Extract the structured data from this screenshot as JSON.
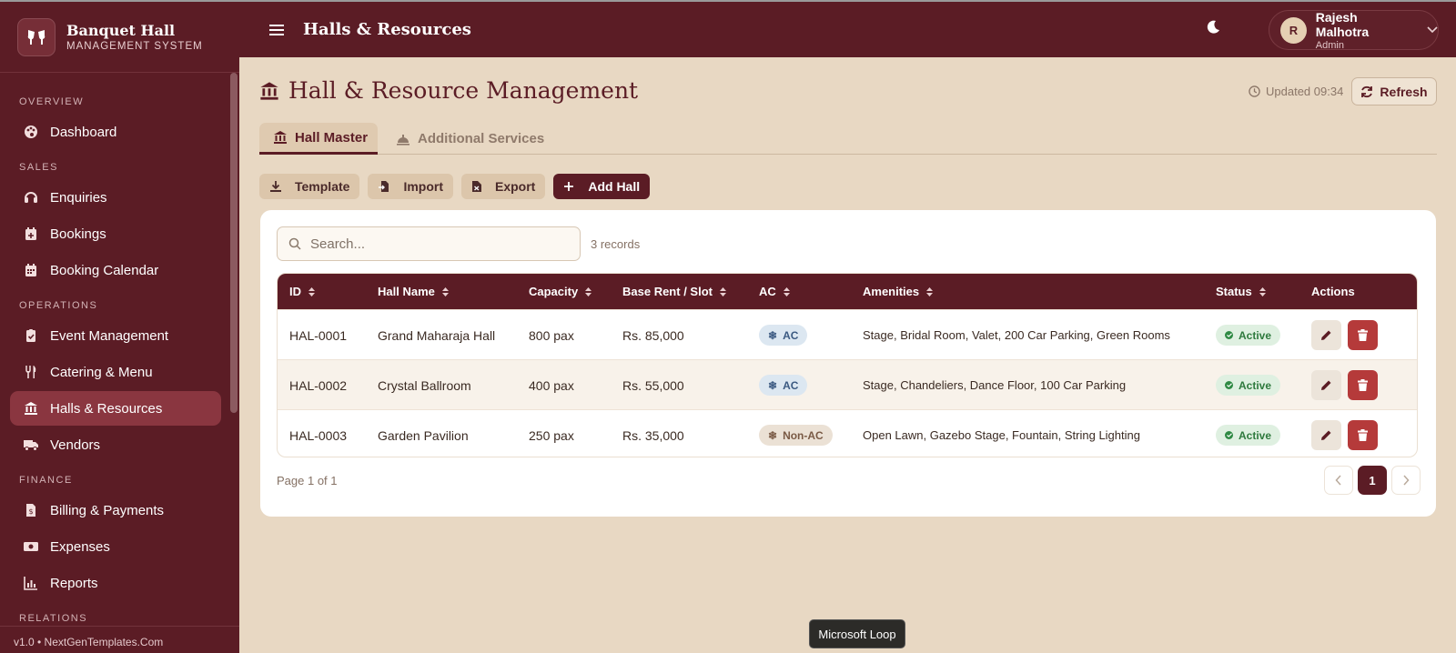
{
  "colors": {
    "brand": "#5b1c25",
    "background": "#e8d8c3",
    "danger": "#b53a3a",
    "success": "#2f7a3e"
  },
  "brand": {
    "title": "Banquet Hall",
    "subtitle": "MANAGEMENT SYSTEM",
    "logo_icon": "cheers-icon"
  },
  "sidebar": {
    "sections": [
      {
        "label": "OVERVIEW",
        "items": [
          {
            "label": "Dashboard",
            "icon": "palette-icon"
          }
        ]
      },
      {
        "label": "SALES",
        "items": [
          {
            "label": "Enquiries",
            "icon": "headset-icon"
          },
          {
            "label": "Bookings",
            "icon": "calendar-plus-icon"
          },
          {
            "label": "Booking Calendar",
            "icon": "calendar-icon"
          }
        ]
      },
      {
        "label": "OPERATIONS",
        "items": [
          {
            "label": "Event Management",
            "icon": "clipboard-check-icon"
          },
          {
            "label": "Catering & Menu",
            "icon": "utensils-icon"
          },
          {
            "label": "Halls & Resources",
            "icon": "building-columns-icon",
            "active": true
          },
          {
            "label": "Vendors",
            "icon": "truck-icon"
          }
        ]
      },
      {
        "label": "FINANCE",
        "items": [
          {
            "label": "Billing & Payments",
            "icon": "invoice-icon"
          },
          {
            "label": "Expenses",
            "icon": "money-icon"
          },
          {
            "label": "Reports",
            "icon": "chart-icon"
          }
        ]
      }
    ],
    "partial_section": "RELATIONS",
    "footer": "v1.0 • NextGenTemplates.Com"
  },
  "header": {
    "title": "Halls & Resources",
    "user_initial": "R",
    "user_name": "Rajesh Malhotra",
    "user_role": "Admin"
  },
  "page": {
    "title": "Hall & Resource Management",
    "updated": "Updated 09:34",
    "refresh_label": "Refresh"
  },
  "tabs": [
    {
      "label": "Hall Master",
      "active": true
    },
    {
      "label": "Additional Services"
    }
  ],
  "toolbar": {
    "template": "Template",
    "import": "Import",
    "export": "Export",
    "add": "Add Hall"
  },
  "search": {
    "placeholder": "Search...",
    "value": ""
  },
  "records": "3 records",
  "table": {
    "columns": [
      "ID",
      "Hall Name",
      "Capacity",
      "Base Rent / Slot",
      "AC",
      "Amenities",
      "Status",
      "Actions"
    ],
    "rows": [
      {
        "id": "HAL-0001",
        "name": "Grand Maharaja Hall",
        "capacity": "800 pax",
        "rent": "Rs. 85,000",
        "ac": "AC",
        "amenities": "Stage, Bridal Room, Valet, 200 Car Parking, Green Rooms",
        "status": "Active"
      },
      {
        "id": "HAL-0002",
        "name": "Crystal Ballroom",
        "capacity": "400 pax",
        "rent": "Rs. 55,000",
        "ac": "AC",
        "amenities": "Stage, Chandeliers, Dance Floor, 100 Car Parking",
        "status": "Active"
      },
      {
        "id": "HAL-0003",
        "name": "Garden Pavilion",
        "capacity": "250 pax",
        "rent": "Rs. 35,000",
        "ac": "Non-AC",
        "amenities": "Open Lawn, Gazebo Stage, Fountain, String Lighting",
        "status": "Active"
      }
    ]
  },
  "pagination": {
    "info": "Page 1 of 1",
    "current": "1"
  },
  "tooltip": "Microsoft Loop"
}
